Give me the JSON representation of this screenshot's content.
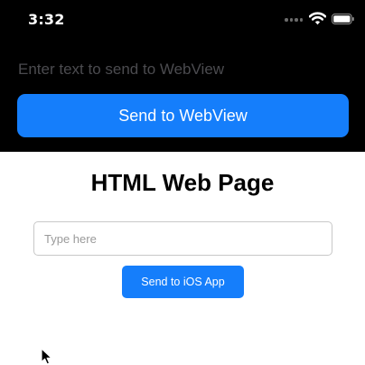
{
  "status_bar": {
    "time": "3:32"
  },
  "native": {
    "input": {
      "placeholder": "Enter text to send to WebView",
      "value": ""
    },
    "send_button_label": "Send to WebView"
  },
  "webview": {
    "title": "HTML Web Page",
    "input": {
      "placeholder": "Type here",
      "value": ""
    },
    "send_button_label": "Send to iOS App"
  },
  "colors": {
    "accent": "#157efb",
    "native_background": "#000000",
    "webview_background": "#ffffff"
  },
  "icons": [
    "wifi-icon",
    "battery-icon",
    "cellular-dots-icon",
    "mouse-cursor-icon"
  ]
}
